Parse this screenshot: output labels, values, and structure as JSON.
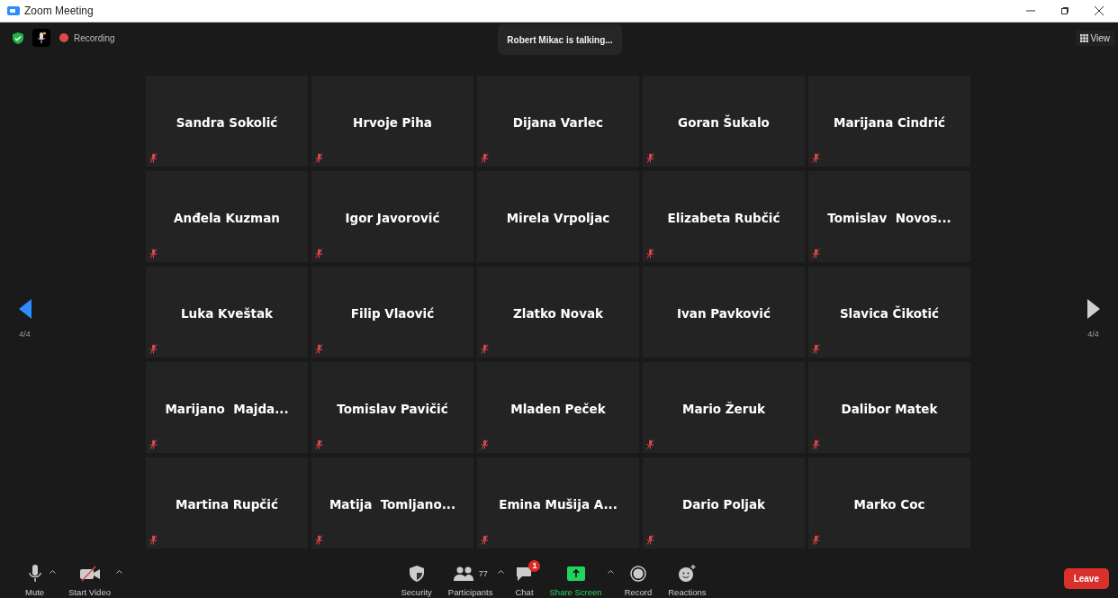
{
  "window": {
    "title": "Zoom Meeting"
  },
  "top_bar": {
    "recording_label": "Recording",
    "view_label": "View"
  },
  "talking_notice": "Robert Mikac is talking...",
  "pager": {
    "left_label": "4/4",
    "right_label": "4/4"
  },
  "participants": [
    {
      "name": "Sandra Sokolić",
      "muted": true
    },
    {
      "name": "Hrvoje Piha",
      "muted": true
    },
    {
      "name": "Dijana Varlec",
      "muted": true
    },
    {
      "name": "Goran Šukalo",
      "muted": true
    },
    {
      "name": "Marijana Cindrić",
      "muted": true
    },
    {
      "name": "Anđela Kuzman",
      "muted": true
    },
    {
      "name": "Igor Javorović",
      "muted": true
    },
    {
      "name": "Mirela Vrpoljac",
      "muted": false
    },
    {
      "name": "Elizabeta Rubčić",
      "muted": true
    },
    {
      "name": "Tomislav  Novos...",
      "muted": true
    },
    {
      "name": "Luka Kveštak",
      "muted": true
    },
    {
      "name": "Filip Vlaović",
      "muted": true
    },
    {
      "name": "Zlatko Novak",
      "muted": true
    },
    {
      "name": "Ivan Pavković",
      "muted": false
    },
    {
      "name": "Slavica Čikotić",
      "muted": true
    },
    {
      "name": "Marijano  Majda...",
      "muted": true
    },
    {
      "name": "Tomislav Pavičić",
      "muted": true
    },
    {
      "name": "Mladen Peček",
      "muted": true
    },
    {
      "name": "Mario Žeruk",
      "muted": true
    },
    {
      "name": "Dalibor Matek",
      "muted": true
    },
    {
      "name": "Martina Rupčić",
      "muted": true
    },
    {
      "name": "Matija  Tomljano...",
      "muted": true
    },
    {
      "name": "Emina Mušija A...",
      "muted": true
    },
    {
      "name": "Dario Poljak",
      "muted": true
    },
    {
      "name": "Marko Coc",
      "muted": true
    }
  ],
  "toolbar": {
    "left": [
      {
        "kind": "mic",
        "label": "Mute",
        "menu_caret": true,
        "highlighted": false
      },
      {
        "kind": "video",
        "label": "Start Video",
        "menu_caret": true,
        "highlighted": false
      }
    ],
    "center": [
      {
        "kind": "security",
        "label": "Security",
        "menu_caret": false,
        "highlighted": false
      },
      {
        "kind": "participants",
        "label": "Participants",
        "count": "77",
        "menu_caret": true,
        "highlighted": false
      },
      {
        "kind": "chat",
        "label": "Chat",
        "badge": "1",
        "menu_caret": false,
        "highlighted": false
      },
      {
        "kind": "share",
        "label": "Share Screen",
        "menu_caret": true,
        "highlighted": true
      },
      {
        "kind": "record",
        "label": "Record",
        "menu_caret": false,
        "highlighted": false
      },
      {
        "kind": "reactions",
        "label": "Reactions",
        "menu_caret": false,
        "highlighted": false
      }
    ],
    "leave_label": "Leave"
  }
}
